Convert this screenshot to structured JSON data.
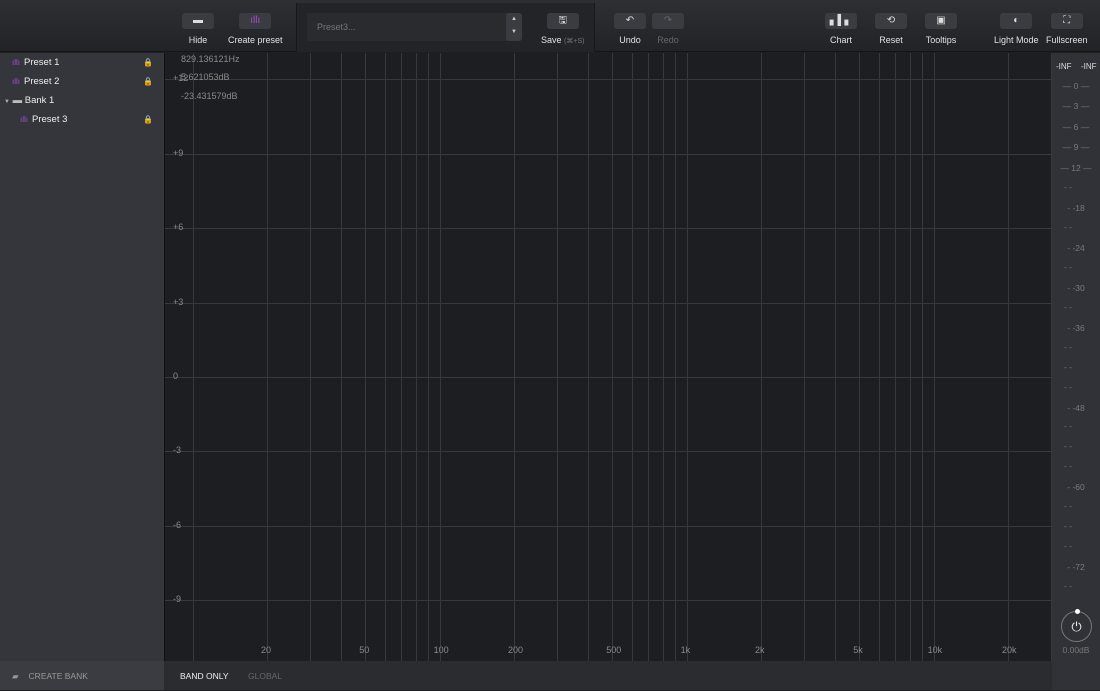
{
  "toolbar": {
    "hide": "Hide",
    "create_preset": "Create preset",
    "preset_name": "Preset3...",
    "save": "Save",
    "save_shortcut": "(⌘+S)",
    "undo": "Undo",
    "redo": "Redo",
    "chart": "Chart",
    "reset": "Reset",
    "tooltips": "Tooltips",
    "light_mode": "Light Mode",
    "fullscreen": "Fullscreen"
  },
  "sidebar": {
    "items": [
      {
        "label": "Preset 1",
        "type": "preset"
      },
      {
        "label": "Preset 2",
        "type": "preset"
      },
      {
        "label": "Bank 1",
        "type": "bank"
      },
      {
        "label": "Preset 3",
        "type": "preset"
      }
    ],
    "create_bank": "CREATE BANK"
  },
  "readouts": {
    "freq": "829.136121Hz",
    "gain": "5.621053dB",
    "level": "-23.431579dB"
  },
  "chart": {
    "db_labels": [
      "+12",
      "+9",
      "+6",
      "+3",
      "0",
      "-3",
      "-6",
      "-9"
    ],
    "freq_labels": [
      "20",
      "50",
      "100",
      "200",
      "500",
      "1k",
      "2k",
      "5k",
      "10k",
      "20k"
    ]
  },
  "footer": {
    "band_only": "BAND ONLY",
    "global": "GLOBAL"
  },
  "meter": {
    "left": "-INF",
    "right": "-INF",
    "scale": [
      "0",
      "3",
      "6",
      "9",
      "12",
      "18",
      "24",
      "30",
      "36",
      "48",
      "60",
      "72"
    ],
    "output": "0.00dB"
  },
  "colors": {
    "accent": "#a24bd8",
    "background": "#1d1e21"
  }
}
